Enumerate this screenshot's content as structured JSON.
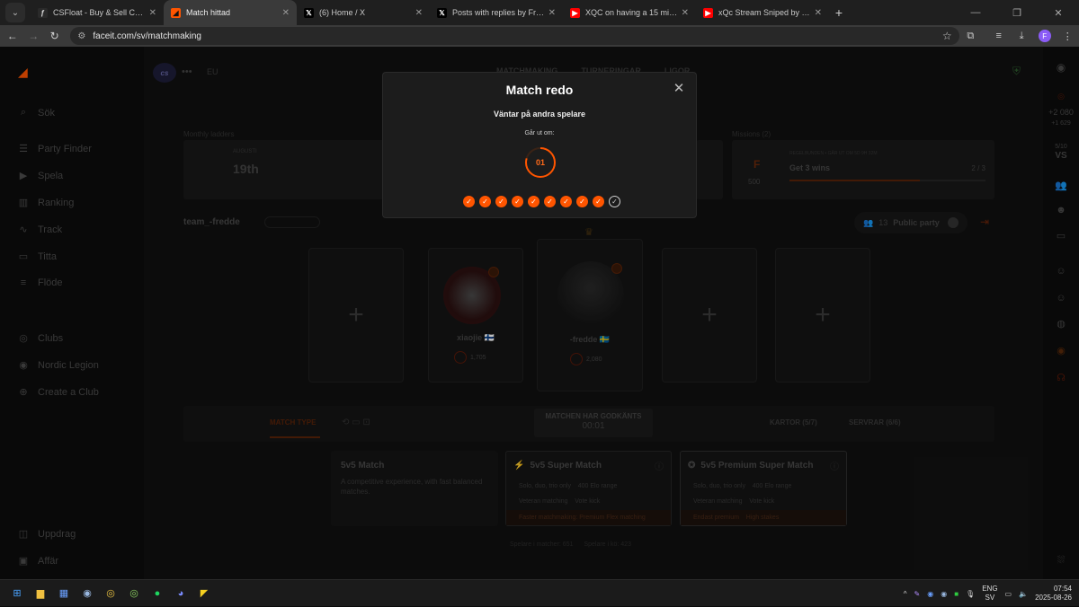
{
  "browser": {
    "tabs": [
      {
        "title": "CSFloat - Buy & Sell CS2 Skins o",
        "fav": "ƒ",
        "favbg": "#2a2a2a",
        "favcolor": "#ddd"
      },
      {
        "title": "Match hittad",
        "fav": "◢",
        "favbg": "#ff5500",
        "favcolor": "#111",
        "active": true
      },
      {
        "title": "(6) Home / X",
        "fav": "𝕏",
        "favbg": "#000",
        "favcolor": "#fff"
      },
      {
        "title": "Posts with replies by Fredrik (@",
        "fav": "𝕏",
        "favbg": "#000",
        "favcolor": "#fff"
      },
      {
        "title": "XQC on having a 15 minute del",
        "fav": "▶",
        "favbg": "#ff0000",
        "favcolor": "#fff"
      },
      {
        "title": "xQc Stream Sniped by Banana S",
        "fav": "▶",
        "favbg": "#ff0000",
        "favcolor": "#fff"
      }
    ],
    "new_tab": "+",
    "url": "faceit.com/sv/matchmaking",
    "profile_letter": "F"
  },
  "nav": {
    "items": [
      {
        "label": "Sök",
        "icon": "⌕",
        "icon_name": "search-icon"
      },
      {
        "label": "Party Finder",
        "icon": "☰",
        "icon_name": "party-finder-icon"
      },
      {
        "label": "Spela",
        "icon": "▶",
        "icon_name": "play-icon"
      },
      {
        "label": "Ranking",
        "icon": "▥",
        "icon_name": "ranking-icon"
      },
      {
        "label": "Track",
        "icon": "∿",
        "icon_name": "track-icon"
      },
      {
        "label": "Titta",
        "icon": "▭",
        "icon_name": "watch-icon"
      },
      {
        "label": "Flöde",
        "icon": "≡",
        "icon_name": "feed-icon"
      },
      {
        "label": "Clubs",
        "icon": "◎",
        "icon_name": "clubs-icon"
      },
      {
        "label": "Nordic Legion",
        "icon": "◉",
        "icon_name": "club-avatar-icon"
      },
      {
        "label": "Create a Club",
        "icon": "⊕",
        "icon_name": "create-club-icon"
      },
      {
        "label": "Uppdrag",
        "icon": "◫",
        "icon_name": "missions-icon"
      },
      {
        "label": "Affär",
        "icon": "▣",
        "icon_name": "shop-icon"
      }
    ]
  },
  "header": {
    "game_logo": "cs",
    "region": "EU",
    "tabs": [
      "MATCHMAKING",
      "TURNERINGAR",
      "LIGOR"
    ]
  },
  "ladders": {
    "label": "Monthly ladders",
    "small": "AUGUSTI",
    "value": "19th"
  },
  "missions": {
    "label": "Missions (2)",
    "small": "REGELBUNDEN • GÅR UT OM 5D 9H 32M",
    "task": "Get 3 wins",
    "progress": "2 / 3",
    "progress_fraction": 0.667,
    "points": "500"
  },
  "party": {
    "name": "team_-fredde",
    "count": "13",
    "visibility": "Public party"
  },
  "members": [
    {
      "name": "xiaojie",
      "elo": "1,705",
      "flag": "🇫🇮"
    },
    {
      "name": "-fredde",
      "elo": "2,080",
      "flag": "🇸🇪"
    }
  ],
  "matchbar": {
    "match_type": "MATCH TYPE",
    "status": "MATCHEN HAR GODKÄNTS",
    "time": "00:01",
    "maps": "KARTOR (5/7)",
    "servers": "SERVRAR (6/6)"
  },
  "modes": [
    {
      "title": "5v5 Match",
      "desc": "A competitive experience, with fast balanced matches."
    },
    {
      "title": "5v5 Super Match",
      "f1": "Solo, duo, trio only",
      "f2": "400 Elo range",
      "f3": "Veteran matching",
      "f4": "Vote kick",
      "f5": "Faster matchmaking: Premium Flex matching"
    },
    {
      "title": "5v5 Premium Super Match",
      "f1": "Solo, duo, trio only",
      "f2": "400 Elo range",
      "f3": "Veteran matching",
      "f4": "Vote kick",
      "f5": "Endast premium",
      "f6": "High stakes"
    }
  ],
  "queue_info": {
    "players": "Spelare i matcher: 651",
    "queue": "Spelare i kö: 423"
  },
  "rail": {
    "elo_top": "+2 080",
    "elo_sub": "+1 629",
    "vs": "VS",
    "pts": "5/10"
  },
  "modal": {
    "title": "Match redo",
    "subtitle": "Väntar på andra spelare",
    "expires_label": "Går ut om:",
    "countdown": "01",
    "accepted": 9,
    "total": 10
  },
  "taskbar": {
    "lang1": "ENG",
    "lang2": "SV",
    "time": "07:54",
    "date": "2025-08-26"
  },
  "colors": {
    "accent": "#ff5500",
    "bg": "#101010",
    "modal": "#1c1c1c"
  }
}
